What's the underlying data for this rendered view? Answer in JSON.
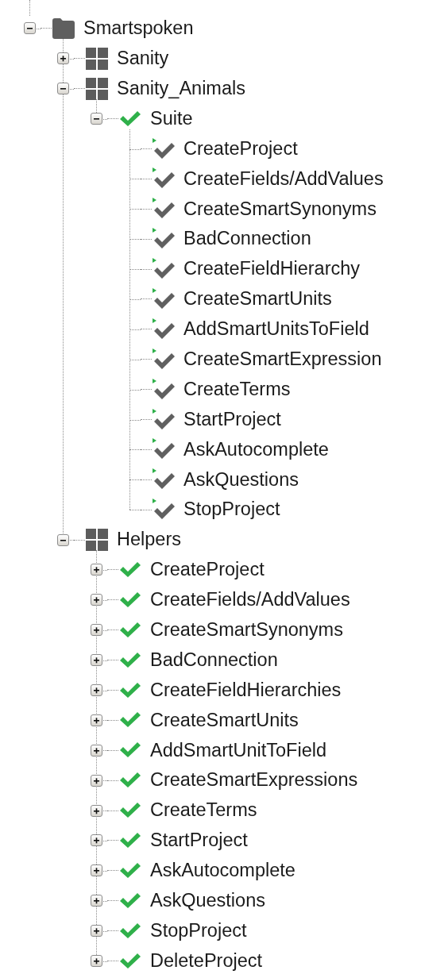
{
  "tree": [
    {
      "kind": "folder",
      "label": "Smartspoken",
      "expanded": true,
      "children": [
        {
          "kind": "group",
          "label": "Sanity",
          "expanded": false
        },
        {
          "kind": "group",
          "label": "Sanity_Animals",
          "expanded": true,
          "children": [
            {
              "kind": "passed",
              "label": "Suite",
              "expanded": true,
              "children": [
                {
                  "kind": "test",
                  "label": "CreateProject"
                },
                {
                  "kind": "test",
                  "label": "CreateFields/AddValues"
                },
                {
                  "kind": "test",
                  "label": "CreateSmartSynonyms"
                },
                {
                  "kind": "test",
                  "label": "BadConnection"
                },
                {
                  "kind": "test",
                  "label": "CreateFieldHierarchy"
                },
                {
                  "kind": "test",
                  "label": "CreateSmartUnits"
                },
                {
                  "kind": "test",
                  "label": "AddSmartUnitsToField"
                },
                {
                  "kind": "test",
                  "label": "CreateSmartExpression"
                },
                {
                  "kind": "test",
                  "label": "CreateTerms"
                },
                {
                  "kind": "test",
                  "label": "StartProject"
                },
                {
                  "kind": "test",
                  "label": "AskAutocomplete"
                },
                {
                  "kind": "test",
                  "label": "AskQuestions"
                },
                {
                  "kind": "test",
                  "label": "StopProject"
                }
              ]
            }
          ]
        },
        {
          "kind": "group",
          "label": "Helpers",
          "expanded": true,
          "children": [
            {
              "kind": "passed",
              "label": "CreateProject",
              "expanded": false
            },
            {
              "kind": "passed",
              "label": "CreateFields/AddValues",
              "expanded": false
            },
            {
              "kind": "passed",
              "label": "CreateSmartSynonyms",
              "expanded": false
            },
            {
              "kind": "passed",
              "label": "BadConnection",
              "expanded": false
            },
            {
              "kind": "passed",
              "label": "CreateFieldHierarchies",
              "expanded": false
            },
            {
              "kind": "passed",
              "label": "CreateSmartUnits",
              "expanded": false
            },
            {
              "kind": "passed",
              "label": "AddSmartUnitToField",
              "expanded": false
            },
            {
              "kind": "passed",
              "label": "CreateSmartExpressions",
              "expanded": false
            },
            {
              "kind": "passed",
              "label": "CreateTerms",
              "expanded": false
            },
            {
              "kind": "passed",
              "label": "StartProject",
              "expanded": false
            },
            {
              "kind": "passed",
              "label": "AskAutocomplete",
              "expanded": false
            },
            {
              "kind": "passed",
              "label": "AskQuestions",
              "expanded": false
            },
            {
              "kind": "passed",
              "label": "StopProject",
              "expanded": false
            },
            {
              "kind": "passed",
              "label": "DeleteProject",
              "expanded": false
            }
          ]
        }
      ]
    }
  ]
}
